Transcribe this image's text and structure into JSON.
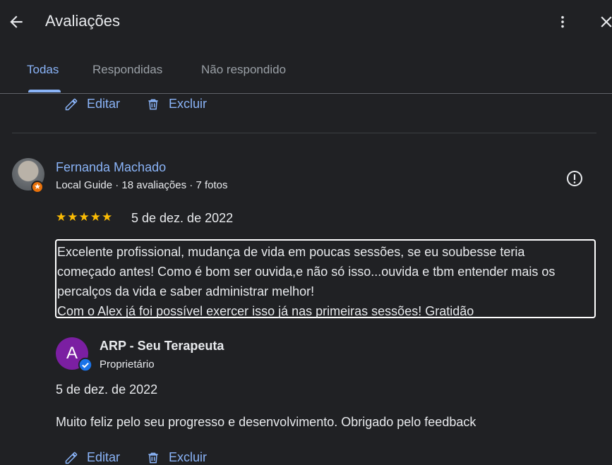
{
  "header": {
    "title": "Avaliações",
    "tabs": [
      {
        "label": "Todas",
        "active": true
      },
      {
        "label": "Respondidas",
        "active": false
      },
      {
        "label": "Não respondido",
        "active": false
      }
    ]
  },
  "actions": {
    "edit_label": "Editar",
    "delete_label": "Excluir"
  },
  "review": {
    "reviewer_name": "Fernanda Machado",
    "reviewer_meta": "Local Guide · 18 avaliações · 7 fotos",
    "rating": 5,
    "stars": "★★★★★",
    "date": "5 de dez. de 2022",
    "text": "Excelente profissional, mudança de vida em poucas sessões, se eu soubesse teria\ncomeçado antes! Como é bom ser ouvida,e não só isso...ouvida e tbm entender mais os\npercalços da vida e saber administrar melhor!\nCom o Alex já foi possível exercer isso já nas primeiras sessões! Gratidão"
  },
  "reply": {
    "avatar_letter": "A",
    "owner_name": "ARP - Seu Terapeuta",
    "owner_role": "Proprietário",
    "date": "5 de dez. de 2022",
    "text": "Muito feliz pelo seu progresso e desenvolvimento. Obrigado pelo feedback"
  },
  "colors": {
    "background": "#202124",
    "accent": "#8ab4f8",
    "star": "#fbbc04",
    "owner_avatar": "#7b1fa2",
    "guide_badge": "#e8710a"
  }
}
